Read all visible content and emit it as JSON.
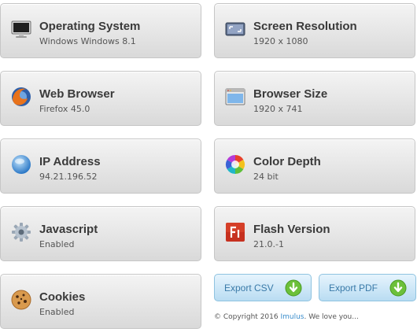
{
  "cards": [
    {
      "title": "Operating System",
      "value": "Windows Windows 8.1",
      "icon": "monitor-icon"
    },
    {
      "title": "Screen Resolution",
      "value": "1920 x 1080",
      "icon": "screen-resolution-icon"
    },
    {
      "title": "Web Browser",
      "value": "Firefox 45.0",
      "icon": "firefox-icon"
    },
    {
      "title": "Browser Size",
      "value": "1920 x 741",
      "icon": "browser-window-icon"
    },
    {
      "title": "IP Address",
      "value": "94.21.196.52",
      "icon": "globe-icon"
    },
    {
      "title": "Color Depth",
      "value": "24 bit",
      "icon": "color-wheel-icon"
    },
    {
      "title": "Javascript",
      "value": "Enabled",
      "icon": "gear-icon"
    },
    {
      "title": "Flash Version",
      "value": "21.0.-1",
      "icon": "flash-icon"
    },
    {
      "title": "Cookies",
      "value": "Enabled",
      "icon": "cookie-icon"
    }
  ],
  "buttons": {
    "export_csv": "Export CSV",
    "export_pdf": "Export PDF",
    "icon": "download-arrow-icon"
  },
  "footer": {
    "prefix": "© Copyright 2016",
    "link": "Imulus",
    "suffix": ". We love you..."
  },
  "colors": {
    "card_border": "#c6c6c6",
    "button_border": "#8fc3e0",
    "button_text": "#3a7aa8",
    "link": "#3a8dcc"
  }
}
